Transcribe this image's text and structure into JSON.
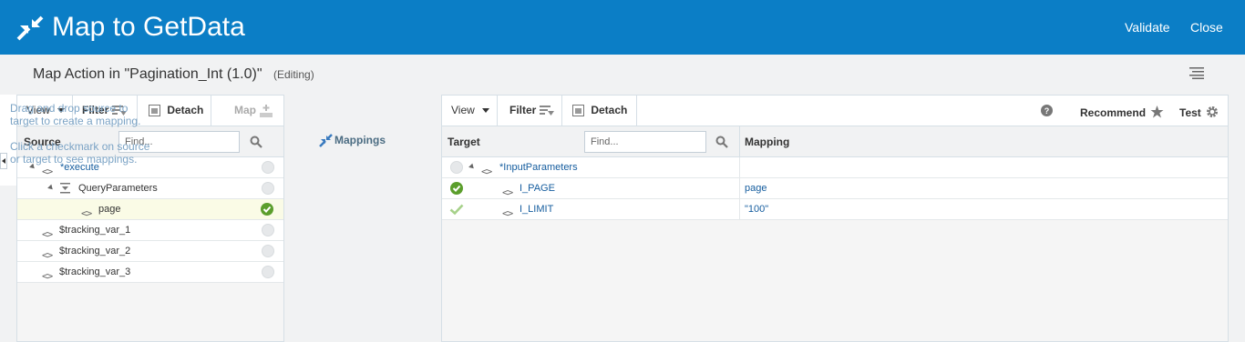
{
  "header": {
    "title": "Map to GetData",
    "validate_label": "Validate",
    "close_label": "Close",
    "background": "#0b7ec6"
  },
  "subheader": {
    "action_title": "Map Action in \"Pagination_Int (1.0)\"",
    "status": "(Editing)"
  },
  "source": {
    "toolbar": {
      "view_label": "View",
      "filter_label": "Filter",
      "detach_label": "Detach",
      "map_label": "Map"
    },
    "column_label": "Source",
    "find_placeholder": "Find...",
    "rows": [
      {
        "label": "*execute",
        "status": "unmapped"
      },
      {
        "label": "QueryParameters",
        "status": "unmapped"
      },
      {
        "label": "page",
        "status": "mapped"
      },
      {
        "label": "$tracking_var_1",
        "status": "unmapped"
      },
      {
        "label": "$tracking_var_2",
        "status": "unmapped"
      },
      {
        "label": "$tracking_var_3",
        "status": "unmapped"
      }
    ]
  },
  "mappings": {
    "label": "Mappings",
    "help_1": "Drag and drop source to target to create a mapping.",
    "help_2": "Click a checkmark on source or target to see mappings."
  },
  "target": {
    "toolbar": {
      "view_label": "View",
      "filter_label": "Filter",
      "detach_label": "Detach",
      "recommend_label": "Recommend",
      "test_label": "Test"
    },
    "column_label": "Target",
    "find_placeholder": "Find...",
    "mapping_column_label": "Mapping",
    "rows": [
      {
        "label": "*InputParameters",
        "mapping": "",
        "status": "unmapped"
      },
      {
        "label": "I_PAGE",
        "mapping": "page",
        "status": "mapped"
      },
      {
        "label": "I_LIMIT",
        "mapping": "\"100\"",
        "status": "mapped-light"
      }
    ]
  },
  "colors": {
    "accent": "#0b7ec6",
    "mapped_green": "#5b9e2c",
    "link_blue": "#145c9e",
    "help_text": "#7ba3c5"
  }
}
